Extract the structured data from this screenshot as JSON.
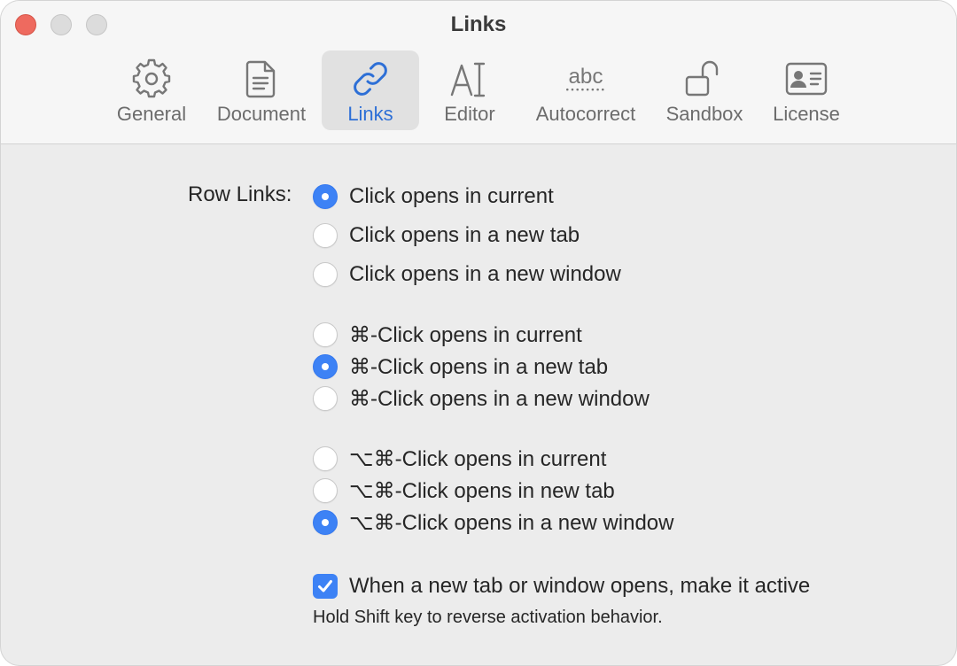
{
  "window": {
    "title": "Links"
  },
  "tabs": [
    {
      "label": "General",
      "icon": "gear-icon"
    },
    {
      "label": "Document",
      "icon": "document-icon"
    },
    {
      "label": "Links",
      "icon": "link-icon",
      "active": true
    },
    {
      "label": "Editor",
      "icon": "text-cursor-icon"
    },
    {
      "label": "Autocorrect",
      "icon": "spellcheck-icon",
      "icon_text": "abc"
    },
    {
      "label": "Sandbox",
      "icon": "unlock-icon"
    },
    {
      "label": "License",
      "icon": "id-card-icon"
    }
  ],
  "row_links": {
    "label": "Row Links:",
    "groups": [
      [
        {
          "label": "Click opens in current",
          "selected": true
        },
        {
          "label": "Click opens in a new tab",
          "selected": false
        },
        {
          "label": "Click opens in a new window",
          "selected": false
        }
      ],
      [
        {
          "label": "⌘-Click opens in current",
          "selected": false
        },
        {
          "label": "⌘-Click opens in a new tab",
          "selected": true
        },
        {
          "label": "⌘-Click opens in a new window",
          "selected": false
        }
      ],
      [
        {
          "label": "⌥⌘-Click opens in current",
          "selected": false
        },
        {
          "label": "⌥⌘-Click opens in new tab",
          "selected": false
        },
        {
          "label": "⌥⌘-Click opens in a new window",
          "selected": true
        }
      ]
    ]
  },
  "activate_option": {
    "label": "When a new tab or window opens, make it active",
    "checked": true,
    "hint": "Hold Shift key to reverse activation behavior."
  },
  "colors": {
    "accent": "#3d82f5",
    "close": "#ee6a5f",
    "active_label": "#2d6fd6"
  }
}
